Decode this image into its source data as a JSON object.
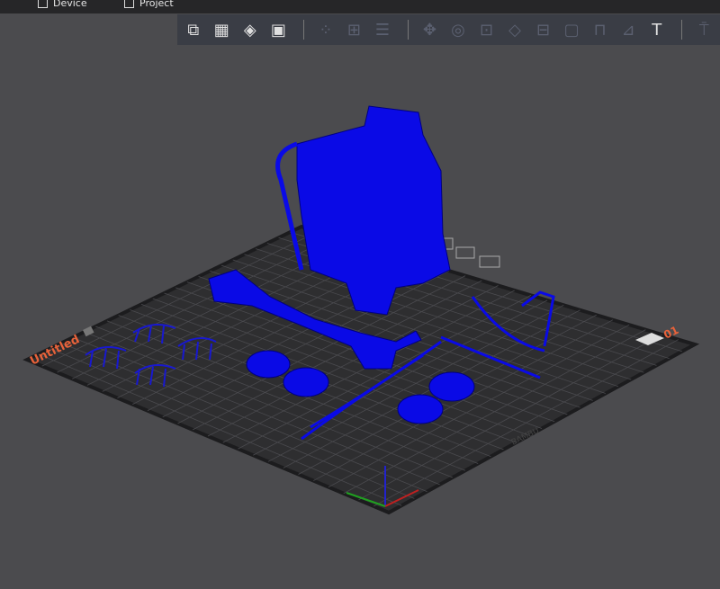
{
  "topbar": {
    "tabs": [
      {
        "label": "Device",
        "icon": "device-icon"
      },
      {
        "label": "Project",
        "icon": "project-icon"
      }
    ]
  },
  "toolbar": {
    "tools": [
      {
        "icon": "add-model-icon",
        "glyph": "⧉",
        "enabled": true
      },
      {
        "icon": "add-plate-icon",
        "glyph": "▦",
        "enabled": true
      },
      {
        "icon": "auto-orient-icon",
        "glyph": "◈",
        "enabled": true
      },
      {
        "icon": "arrange-icon",
        "glyph": "▣",
        "enabled": true
      },
      {
        "icon": "split-objects-icon",
        "glyph": "⁘",
        "enabled": false
      },
      {
        "icon": "split-parts-icon",
        "glyph": "⊞",
        "enabled": false
      },
      {
        "icon": "layers-icon",
        "glyph": "☰",
        "enabled": false
      },
      {
        "icon": "move-icon",
        "glyph": "✥",
        "enabled": false
      },
      {
        "icon": "rotate-icon",
        "glyph": "◎",
        "enabled": false
      },
      {
        "icon": "scale-icon",
        "glyph": "⊡",
        "enabled": false
      },
      {
        "icon": "lay-on-face-icon",
        "glyph": "◇",
        "enabled": false
      },
      {
        "icon": "cut-icon",
        "glyph": "⊟",
        "enabled": false
      },
      {
        "icon": "support-paint-icon",
        "glyph": "▢",
        "enabled": false
      },
      {
        "icon": "seam-paint-icon",
        "glyph": "⊓",
        "enabled": false
      },
      {
        "icon": "color-paint-icon",
        "glyph": "⊿",
        "enabled": false
      },
      {
        "icon": "text-icon",
        "glyph": "T",
        "enabled": true
      },
      {
        "icon": "measure-icon",
        "glyph": "⍑",
        "enabled": false
      }
    ]
  },
  "plate": {
    "name": "Untitled",
    "number": "01",
    "brand": "BAMBU",
    "model_color": "#0a0ae6",
    "plate_color": "#2e2e30",
    "label_color": "#e8623a"
  }
}
